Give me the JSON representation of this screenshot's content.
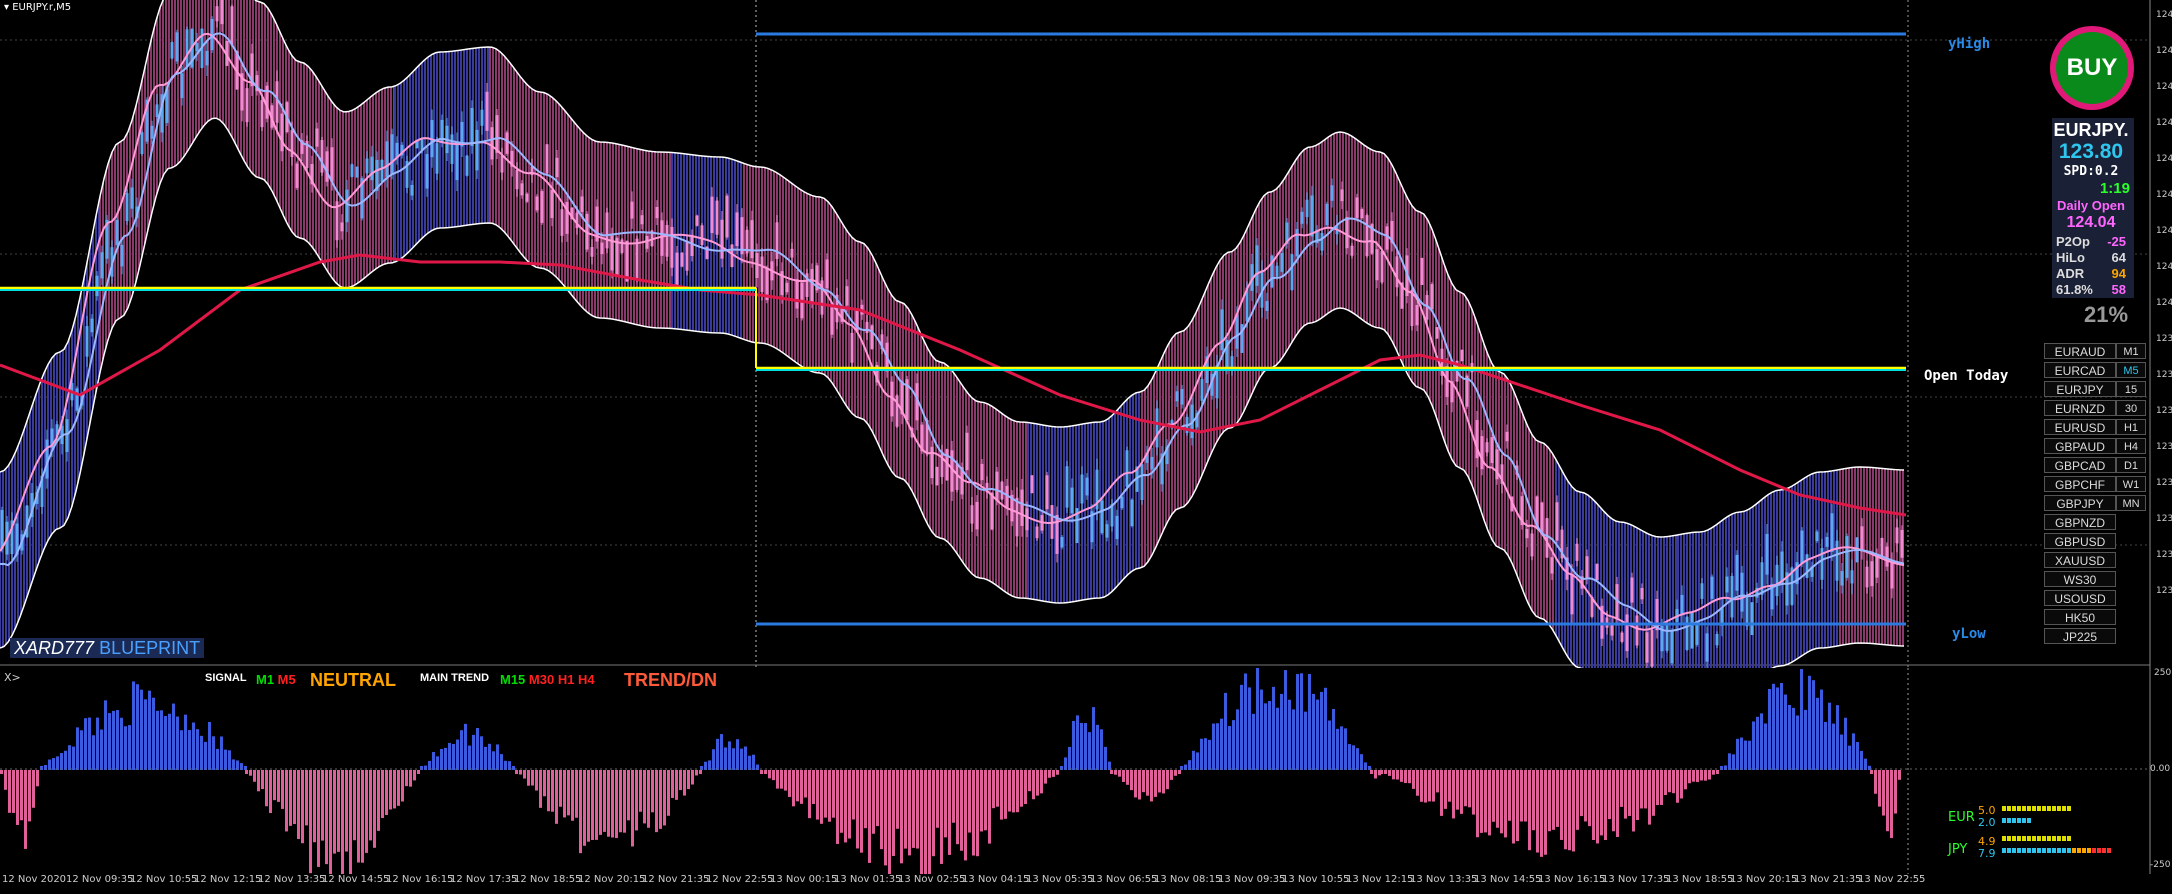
{
  "chart_title": "EURJPY.r,M5",
  "brand": {
    "left": "XARD777",
    "right": "BLUEPRINT"
  },
  "levels": {
    "yhigh": "yHigh",
    "ylow": "yLow",
    "open_today": "Open Today"
  },
  "buy_button": "BUY",
  "info_panel": {
    "symbol": "EURJPY.",
    "price": "123.80",
    "spread": "SPD:0.2",
    "countdown": "1:19",
    "daily_open_label": "Daily Open",
    "daily_open": "124.04",
    "rows": [
      {
        "label": "P2Op",
        "value": "-25",
        "color": "#ff66ff"
      },
      {
        "label": "HiLo",
        "value": "64",
        "color": "#dddddd"
      },
      {
        "label": "ADR",
        "value": "94",
        "color": "#ffa500"
      },
      {
        "label": "61.8%",
        "value": "58",
        "color": "#ff66ff"
      }
    ],
    "percent": "21%"
  },
  "pairs": [
    "EURAUD",
    "EURCAD",
    "EURJPY",
    "EURNZD",
    "EURUSD",
    "GBPAUD",
    "GBPCAD",
    "GBPCHF",
    "GBPJPY",
    "GBPNZD",
    "GBPUSD",
    "XAUUSD",
    "WS30",
    "USOUSD",
    "HK50",
    "JP225"
  ],
  "timeframes": [
    "M1",
    "M5",
    "15",
    "30",
    "H1",
    "H4",
    "D1",
    "W1",
    "MN"
  ],
  "active_timeframe": "M5",
  "signal_bar": {
    "prompt": "X>",
    "signal_label": "SIGNAL",
    "signal_tfs": [
      {
        "t": "M1",
        "c": "#00dd00"
      },
      {
        "t": "M5",
        "c": "#ff2020"
      }
    ],
    "signal_state": "NEUTRAL",
    "main_label": "MAIN TREND",
    "main_tfs": [
      {
        "t": "M15",
        "c": "#00dd00"
      },
      {
        "t": "M30",
        "c": "#ff2020"
      },
      {
        "t": "H1",
        "c": "#ff2020"
      },
      {
        "t": "H4",
        "c": "#ff2020"
      }
    ],
    "main_state": "TREND/DN"
  },
  "strength": {
    "eur": {
      "label": "EUR",
      "v1": "5.0",
      "v2": "2.0"
    },
    "jpy": {
      "label": "JPY",
      "v1": "4.9",
      "v2": "7.9"
    }
  },
  "osc_scale": {
    "top": "250",
    "zero": "0.00",
    "bottom": "-250"
  },
  "x_labels": [
    "12 Nov 2020",
    "12 Nov 09:35",
    "12 Nov 10:55",
    "12 Nov 12:15",
    "12 Nov 13:35",
    "12 Nov 14:55",
    "12 Nov 16:15",
    "12 Nov 17:35",
    "12 Nov 18:55",
    "12 Nov 20:15",
    "12 Nov 21:35",
    "12 Nov 22:55",
    "13 Nov 00:15",
    "13 Nov 01:35",
    "13 Nov 02:55",
    "13 Nov 04:15",
    "13 Nov 05:35",
    "13 Nov 06:55",
    "13 Nov 08:15",
    "13 Nov 09:35",
    "13 Nov 10:55",
    "13 Nov 12:15",
    "13 Nov 13:35",
    "13 Nov 14:55",
    "13 Nov 16:15",
    "13 Nov 17:35",
    "13 Nov 18:55",
    "13 Nov 20:15",
    "13 Nov 21:35",
    "13 Nov 22:55"
  ],
  "y_labels": [
    "124.",
    "124.",
    "124.",
    "124.",
    "124.",
    "124.",
    "124.",
    "124.",
    "124.",
    "123.",
    "123.",
    "123.",
    "123.",
    "123.",
    "123.",
    "123.",
    "123."
  ],
  "colors": {
    "bull": "#3c5ae0",
    "bear": "#e0609a",
    "band_bull": "#3a3a9a",
    "band_bear": "#8a3a6a",
    "ma": "#e01848",
    "yellow": "#ffff00",
    "cyan": "#00e0e0",
    "level_blue": "#2a7ae0"
  }
}
